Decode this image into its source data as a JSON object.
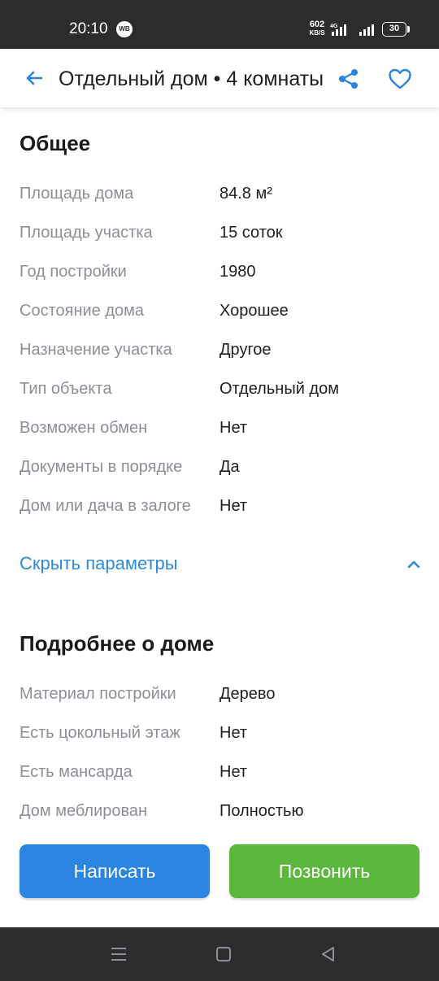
{
  "status_bar": {
    "time": "20:10",
    "app_badge": "WB",
    "net_speed_value": "602",
    "net_speed_unit": "KB/S",
    "network_type": "4G",
    "battery": "30"
  },
  "header": {
    "title": "Отдельный дом • 4 комнаты",
    "back_icon": "arrow-left-icon",
    "share_icon": "share-icon",
    "favorite_icon": "heart-outline-icon"
  },
  "general": {
    "title": "Общее",
    "rows": [
      {
        "label": "Площадь дома",
        "value": "84.8 м²"
      },
      {
        "label": "Площадь участка",
        "value": "15 соток"
      },
      {
        "label": "Год постройки",
        "value": "1980"
      },
      {
        "label": "Состояние дома",
        "value": "Хорошее"
      },
      {
        "label": "Назначение участка",
        "value": "Другое"
      },
      {
        "label": "Тип объекта",
        "value": "Отдельный дом"
      },
      {
        "label": "Возможен обмен",
        "value": "Нет"
      },
      {
        "label": "Документы в порядке",
        "value": "Да"
      },
      {
        "label": "Дом или дача в залоге",
        "value": "Нет"
      }
    ],
    "toggle_label": "Скрыть параметры"
  },
  "house_details": {
    "title": "Подробнее о доме",
    "rows": [
      {
        "label": "Материал постройки",
        "value": "Дерево"
      },
      {
        "label": "Есть цокольный этаж",
        "value": "Нет"
      },
      {
        "label": "Есть мансарда",
        "value": "Нет"
      },
      {
        "label": "Дом меблирован",
        "value": "Полностью"
      }
    ]
  },
  "actions": {
    "write_label": "Написать",
    "call_label": "Позвонить"
  },
  "colors": {
    "accent_blue": "#2b84e0",
    "link_blue": "#2d8ad8",
    "call_green": "#5cb83c",
    "label_gray": "#8b8f96",
    "system_bar": "#2c2c2e"
  }
}
